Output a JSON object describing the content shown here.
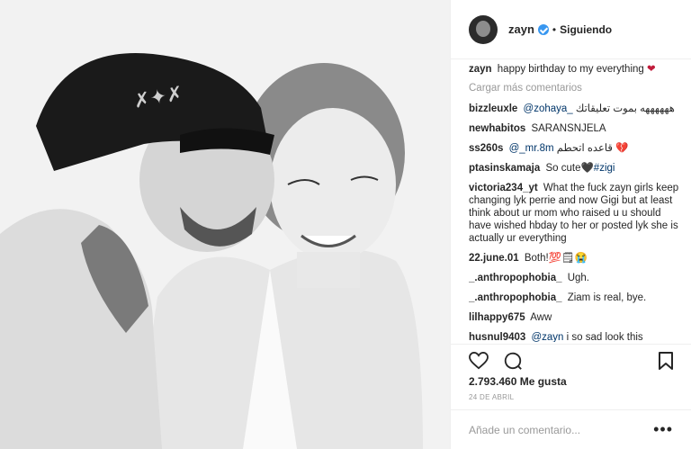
{
  "header": {
    "username": "zayn",
    "follow_status": "Siguiendo"
  },
  "caption": {
    "user": "zayn",
    "text": "happy birthday to my everything",
    "emoji": "❤"
  },
  "load_more": "Cargar más comentarios",
  "comments": [
    {
      "user": "bizzleuxle",
      "mention": "@zohaya_",
      "text": "ههههههه بموت تعليقاتك"
    },
    {
      "user": "newhabitos",
      "text": "SARANSNJELA"
    },
    {
      "user": "ss260s",
      "mention": "@_mr.8m",
      "text": "قاعده اتحطم 💔"
    },
    {
      "user": "ptasinskamaja",
      "text": "So cute🖤",
      "mention_after": "#zigi"
    },
    {
      "user": "victoria234_yt",
      "text": "What the fuck zayn girls keep changing lyk perrie and now Gigi but at least think about ur mom who raised u u should have wished hbday to her or posted lyk she is actually ur everything"
    },
    {
      "user": "22.june.01",
      "text": "Both!💯🗒😭"
    },
    {
      "user": "_.anthropophobia_",
      "text": "Ugh."
    },
    {
      "user": "_.anthropophobia_",
      "text": "Ziam is real, bye."
    },
    {
      "user": "lilhappy675",
      "text": "Aww"
    },
    {
      "user": "husnul9403",
      "mention": "@zayn",
      "text": "i so sad look this"
    }
  ],
  "likes": "2.793.460 Me gusta",
  "date": "24 DE ABRIL",
  "add_comment": {
    "placeholder": "Añade un comentario..."
  },
  "icons": {
    "like": "heart-icon",
    "comment": "comment-icon",
    "save": "bookmark-icon",
    "more": "more-options-icon",
    "verified": "verified-badge-icon"
  },
  "colors": {
    "verified": "#3897f0",
    "heart": "#c11c3b",
    "muted": "#999999"
  }
}
